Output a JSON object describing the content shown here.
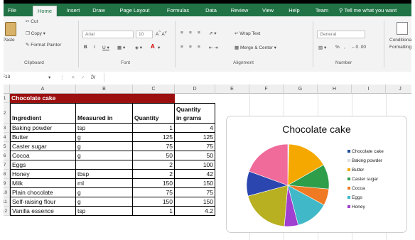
{
  "ribbon": {
    "tabs": [
      "File",
      "Home",
      "Insert",
      "Draw",
      "Page Layout",
      "Formulas",
      "Data",
      "Review",
      "View",
      "Help",
      "Team"
    ],
    "active_tab": "Home",
    "tell_me": "Tell me what you want",
    "clipboard": {
      "paste": "Paste",
      "cut": "Cut",
      "copy": "Copy",
      "format_painter": "Format Painter",
      "label": "Clipboard"
    },
    "font": {
      "name": "Arial",
      "size": "10",
      "label": "Font"
    },
    "alignment": {
      "wrap_text": "Wrap Text",
      "merge_center": "Merge & Center",
      "label": "Alignment"
    },
    "number": {
      "format": "General",
      "label": "Number"
    },
    "styles": {
      "conditional": "Conditional",
      "formatting": "Formatting"
    }
  },
  "formula_bar": {
    "name_box": "F13",
    "fx": "fx"
  },
  "columns": [
    "A",
    "B",
    "C",
    "D",
    "E",
    "F",
    "G",
    "H",
    "I",
    "J"
  ],
  "rows": [
    "1",
    "2",
    "3",
    "4",
    "5",
    "6",
    "7",
    "8",
    "9",
    "10",
    "11",
    "12"
  ],
  "sheet": {
    "title": "Chocolate cake",
    "headers": {
      "ingredient": "Ingredient",
      "measured_in": "Measured in",
      "quantity": "Quantity",
      "grams_line1": "Quantity",
      "grams_line2": "in grams"
    },
    "rows": [
      {
        "ingredient": "Baking powder",
        "measured_in": "tsp",
        "quantity": "1",
        "grams": "4"
      },
      {
        "ingredient": "Butter",
        "measured_in": "g",
        "quantity": "125",
        "grams": "125"
      },
      {
        "ingredient": "Caster sugar",
        "measured_in": "g",
        "quantity": "75",
        "grams": "75"
      },
      {
        "ingredient": "Cocoa",
        "measured_in": "g",
        "quantity": "50",
        "grams": "50"
      },
      {
        "ingredient": "Eggs",
        "measured_in": "",
        "quantity": "2",
        "grams": "100"
      },
      {
        "ingredient": "Honey",
        "measured_in": "tbsp",
        "quantity": "2",
        "grams": "42"
      },
      {
        "ingredient": "Milk",
        "measured_in": "ml",
        "quantity": "150",
        "grams": "150"
      },
      {
        "ingredient": "Plain chocolate",
        "measured_in": "g",
        "quantity": "75",
        "grams": "75"
      },
      {
        "ingredient": "Self-raising flour",
        "measured_in": "g",
        "quantity": "150",
        "grams": "150"
      },
      {
        "ingredient": "Vanilla essence",
        "measured_in": "tsp",
        "quantity": "1",
        "grams": "4.2"
      }
    ]
  },
  "chart_data": {
    "type": "pie",
    "title": "Chocolate cake",
    "categories": [
      "Chocolate cake",
      "Baking powder",
      "Butter",
      "Caster sugar",
      "Cocoa",
      "Eggs",
      "Honey",
      "Milk",
      "Plain chocolate",
      "Self-raising flour"
    ],
    "values": [
      0,
      4,
      125,
      75,
      50,
      100,
      42,
      150,
      75,
      150
    ],
    "legend_entries": [
      "Chocolate cake",
      "Baking powder",
      "Butter",
      "Caster sugar",
      "Cocoa",
      "Eggs",
      "Honey"
    ],
    "legend_position": "right",
    "colors": [
      "#1f4e9c",
      "#e0e0e0",
      "#f5a800",
      "#2e9e4a",
      "#f07a24",
      "#40b8c8",
      "#a040d0",
      "#b8b020",
      "#2c46b0",
      "#f06a9a"
    ]
  }
}
